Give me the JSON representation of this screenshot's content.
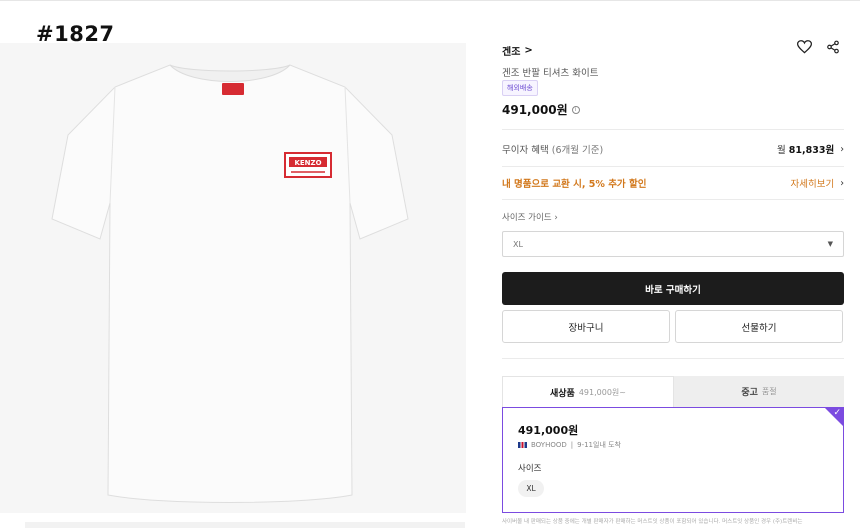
{
  "overlay": {
    "id_label": "#1827"
  },
  "product": {
    "brand": "겐조",
    "brand_chevron": ">",
    "name": "겐조 반팔 티셔츠 화이트",
    "badge": "해외배송",
    "price": "491,000원",
    "image_logo_text": "KENZO"
  },
  "installment": {
    "label": "무이자 혜택",
    "sub": "(6개월 기준)",
    "monthly_prefix": "월",
    "monthly_amount": "81,833원"
  },
  "trade_in": {
    "label": "내 명품으로 교환 시, 5% 추가 할인",
    "link": "자세히보기"
  },
  "size": {
    "guide_label": "사이즈 가이드",
    "selected": "XL"
  },
  "buttons": {
    "buy": "바로 구매하기",
    "cart": "장바구니",
    "gift": "선물하기"
  },
  "tabs": [
    {
      "label": "새상품",
      "sub": "491,000원~"
    },
    {
      "label": "중고",
      "sub": "품절"
    }
  ],
  "offer": {
    "price": "491,000원",
    "seller": "BOYHOOD",
    "eta": "9-11일내 도착",
    "size_label": "사이즈",
    "size_value": "XL"
  },
  "footnote": "사이버몰 내 판매되는 상품 중에는 개별 판매자가 판매하는 머스트잇 상품이 포함되어 있습니다. 머스트잇 상품인 경우 (주)트렌비는",
  "colors": {
    "accent_purple": "#7b4be0",
    "orange": "#d2781c",
    "buy_button": "#1c1c1c",
    "logo_red": "#d62b32"
  },
  "icons": [
    "heart-icon",
    "share-icon",
    "info-icon",
    "chevron-right-icon",
    "caret-down-icon",
    "check-icon",
    "uk-flag-icon"
  ]
}
